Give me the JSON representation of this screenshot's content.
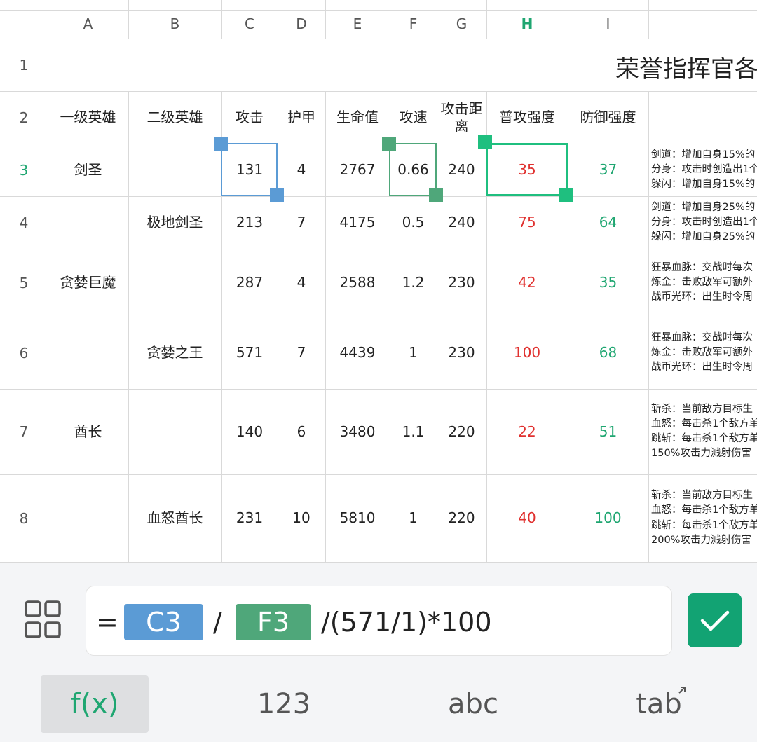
{
  "sheet": {
    "columns": [
      "A",
      "B",
      "C",
      "D",
      "E",
      "F",
      "G",
      "H",
      "I"
    ],
    "active_column": "H",
    "active_row": "3",
    "title": "荣誉指挥官各英",
    "header_row": {
      "row": "2",
      "cells": [
        "一级英雄",
        "二级英雄",
        "攻击",
        "护甲",
        "生命值",
        "攻速",
        "攻击距\n离",
        "普攻强度",
        "防御强度",
        ""
      ]
    },
    "rows": [
      {
        "row": "3",
        "cells": [
          "剑圣",
          "",
          "131",
          "4",
          "2767",
          "0.66",
          "240",
          "35",
          "37",
          "剑道：增加自身15%的\n分身：攻击时创造出1个\n躲闪：增加自身15%的"
        ]
      },
      {
        "row": "4",
        "cells": [
          "",
          "极地剑圣",
          "213",
          "7",
          "4175",
          "0.5",
          "240",
          "75",
          "64",
          "剑道：增加自身25%的\n分身：攻击时创造出1个\n躲闪：增加自身25%的"
        ]
      },
      {
        "row": "5",
        "cells": [
          "贪婪巨魔",
          "",
          "287",
          "4",
          "2588",
          "1.2",
          "230",
          "42",
          "35",
          "狂暴血脉：交战时每次\n炼金：击败敌军可额外\n战币光环：出生时令周"
        ]
      },
      {
        "row": "6",
        "cells": [
          "",
          "贪婪之王",
          "571",
          "7",
          "4439",
          "1",
          "230",
          "100",
          "68",
          "狂暴血脉：交战时每次\n炼金：击败敌军可额外\n战币光环：出生时令周"
        ]
      },
      {
        "row": "7",
        "cells": [
          "酋长",
          "",
          "140",
          "6",
          "3480",
          "1.1",
          "220",
          "22",
          "51",
          "斩杀：当前敌方目标生\n血怒：每击杀1个敌方单\n跳斩：每击杀1个敌方单\n150%攻击力溅射伤害"
        ]
      },
      {
        "row": "8",
        "cells": [
          "",
          "血怒酋长",
          "231",
          "10",
          "5810",
          "1",
          "220",
          "40",
          "100",
          "斩杀：当前敌方目标生\n血怒：每击杀1个敌方单\n跳斩：每击杀1个敌方单\n200%攻击力溅射伤害"
        ]
      }
    ]
  },
  "formula": {
    "equals": "=",
    "ref1": "C3",
    "op1": "/",
    "ref2": "F3",
    "rest": "/(571/1)*100"
  },
  "keyboard": {
    "tabs": [
      {
        "label": "f(x)",
        "active": true
      },
      {
        "label": "123",
        "active": false
      },
      {
        "label": "abc",
        "active": false
      },
      {
        "label": "tab",
        "active": false
      }
    ]
  },
  "colors": {
    "ref1": "#5b9bd5",
    "ref2": "#4fa77a",
    "active_cell": "#1fbf7f",
    "confirm": "#12a373",
    "red_value": "#e0312f",
    "green_value": "#1fa671"
  },
  "icons": {
    "grid_toggle": "grid-layout-icon",
    "confirm": "checkmark-icon",
    "tab_arrow": "arrow-up-right-icon"
  }
}
